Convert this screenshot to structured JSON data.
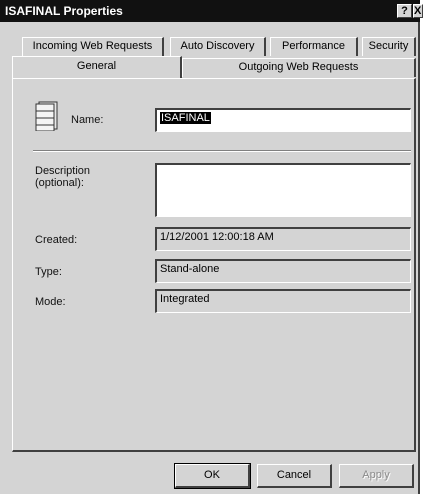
{
  "window": {
    "title": "ISAFINAL Properties",
    "help_label": "?",
    "close_label": "X"
  },
  "tabs_row1": [
    {
      "label": "Incoming Web Requests"
    },
    {
      "label": "Auto Discovery"
    },
    {
      "label": "Performance"
    },
    {
      "label": "Security"
    }
  ],
  "tabs_row2": [
    {
      "label": "General",
      "active": true
    },
    {
      "label": "Outgoing Web Requests"
    }
  ],
  "general": {
    "name_label": "Name:",
    "name_value": "ISAFINAL",
    "description_label": "Description\n(optional):",
    "description_value": "",
    "created_label": "Created:",
    "created_value": "1/12/2001 12:00:18 AM",
    "type_label": "Type:",
    "type_value": "Stand-alone",
    "mode_label": "Mode:",
    "mode_value": "Integrated",
    "server_icon": "server-icon"
  },
  "buttons": {
    "ok": "OK",
    "cancel": "Cancel",
    "apply": "Apply"
  }
}
